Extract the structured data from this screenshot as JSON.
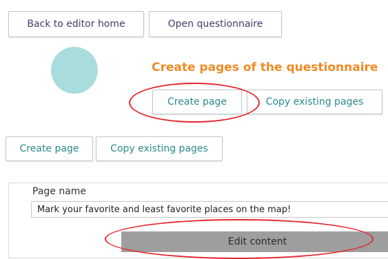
{
  "nav": {
    "back_label": "Back to editor home",
    "open_label": "Open questionnaire"
  },
  "illustration": {
    "heading": "Create pages of the questionnaire",
    "create_label": "Create page",
    "copy_label": "Copy existing pages"
  },
  "toolbar": {
    "create_label": "Create page",
    "copy_label": "Copy existing pages"
  },
  "page_form": {
    "name_label": "Page name",
    "name_value": "Mark your favorite and least favorite places on the map!",
    "edit_label": "Edit content"
  },
  "colors": {
    "accent_orange": "#f08a24",
    "avatar_teal": "#a9dcdc",
    "button_text_teal": "#2a8a8a",
    "highlight_red": "#e3272f",
    "edit_button_gray": "#9e9e9e"
  }
}
